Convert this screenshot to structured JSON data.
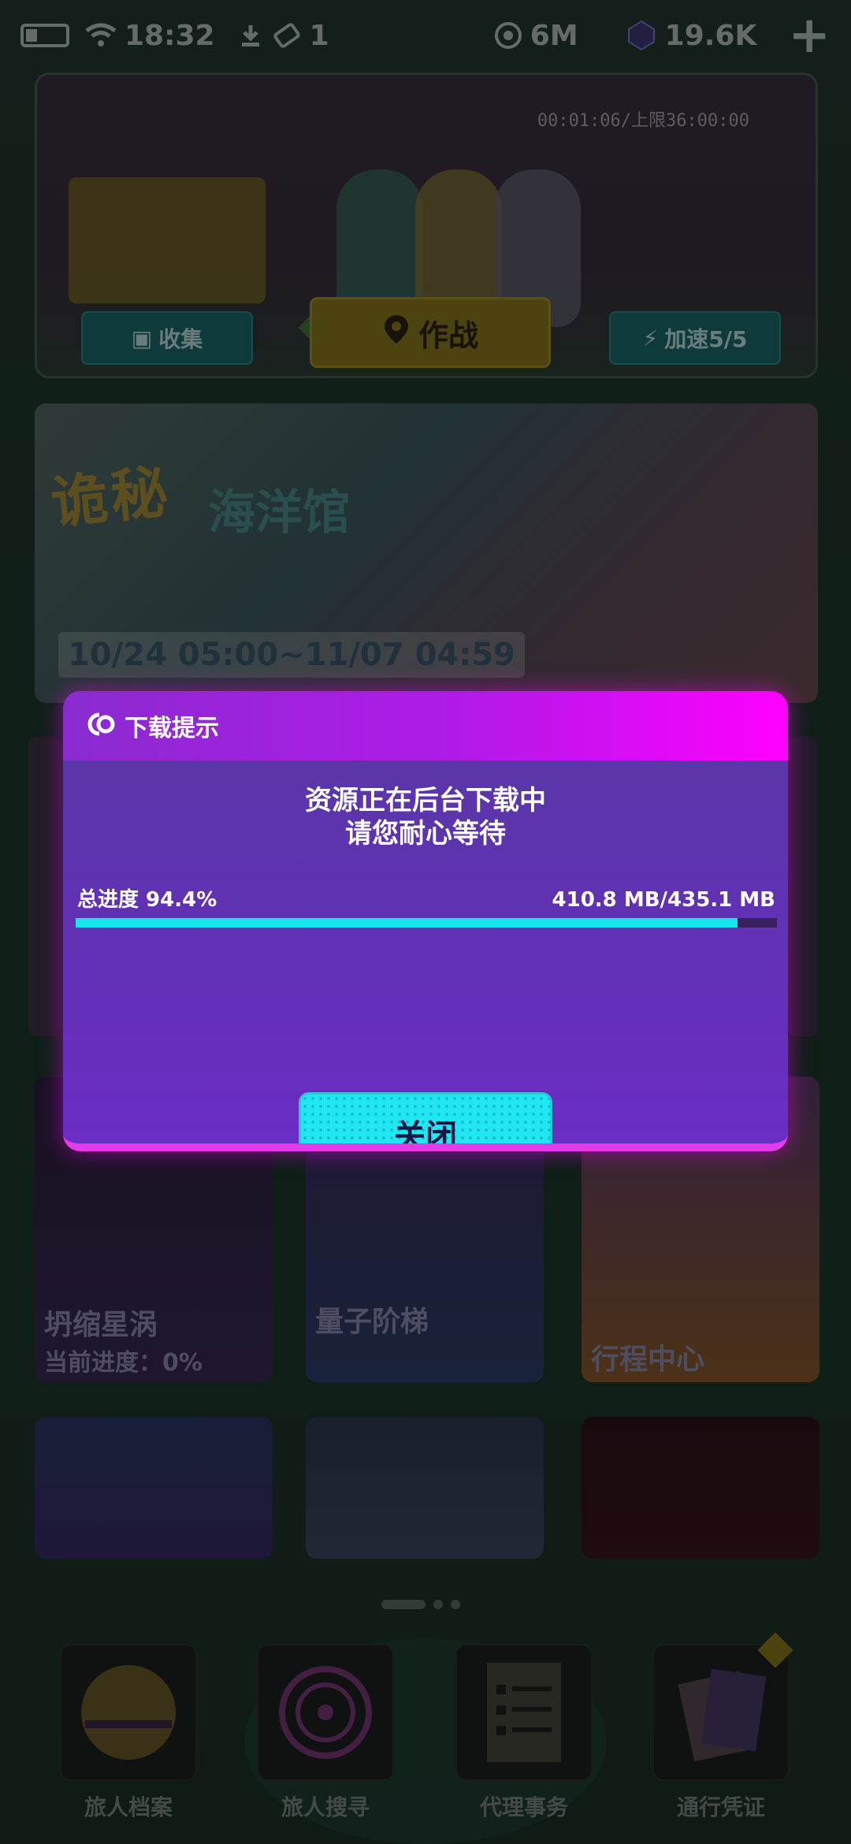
{
  "status_bar": {
    "time": "18:32",
    "items_count": "1",
    "coins": "6M",
    "gems": "19.6K"
  },
  "top_card": {
    "timer": "00:01:06/上限36:00:00",
    "collect_label": "收集",
    "battle_label": "作战",
    "boost_label": "加速5/5"
  },
  "banner": {
    "title_part1": "诡秘",
    "title_part2": "海洋馆",
    "date_range": "10/24 05:00~11/07 04:59"
  },
  "cards": [
    {
      "title": "坍缩星涡",
      "progress": "当前进度：0%"
    },
    {
      "title": "量子阶梯"
    },
    {
      "title": "行程中心"
    }
  ],
  "dock": [
    {
      "label": "旅人档案"
    },
    {
      "label": "旅人搜寻"
    },
    {
      "label": "代理事务"
    },
    {
      "label": "通行凭证"
    }
  ],
  "dialog": {
    "title": "下载提示",
    "message_line1": "资源正在后台下载中",
    "message_line2": "请您耐心等待",
    "progress_label": "总进度  94.4%",
    "progress_percent": 94.4,
    "size": "410.8 MB/435.1 MB",
    "close_label": "关闭"
  },
  "colors": {
    "accent_cyan": "#20e7f2",
    "dialog_purple": "#6a2cc4",
    "header_magenta": "#ff00ff"
  }
}
